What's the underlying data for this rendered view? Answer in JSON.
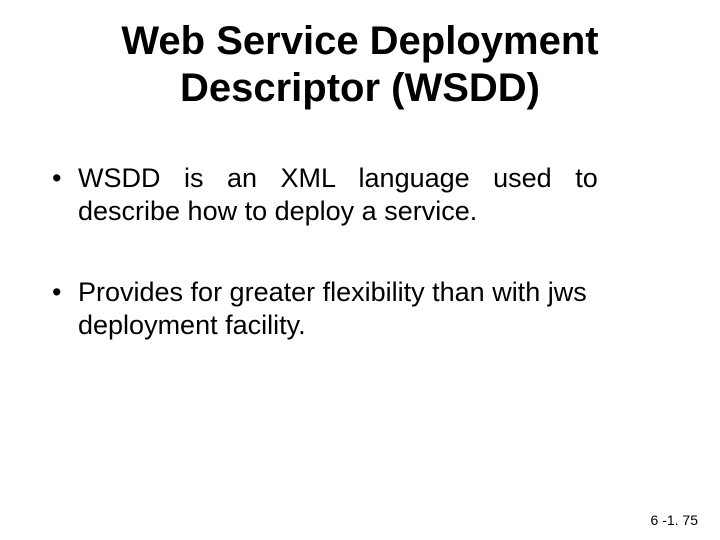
{
  "title": "Web Service Deployment\nDescriptor (WSDD)",
  "bullets": [
    {
      "line1": "WSDD is an XML language used to",
      "line2": "describe how to deploy a service."
    },
    {
      "text": "Provides for greater flexibility than with jws deployment facility."
    }
  ],
  "footer": "6 -1. 75"
}
